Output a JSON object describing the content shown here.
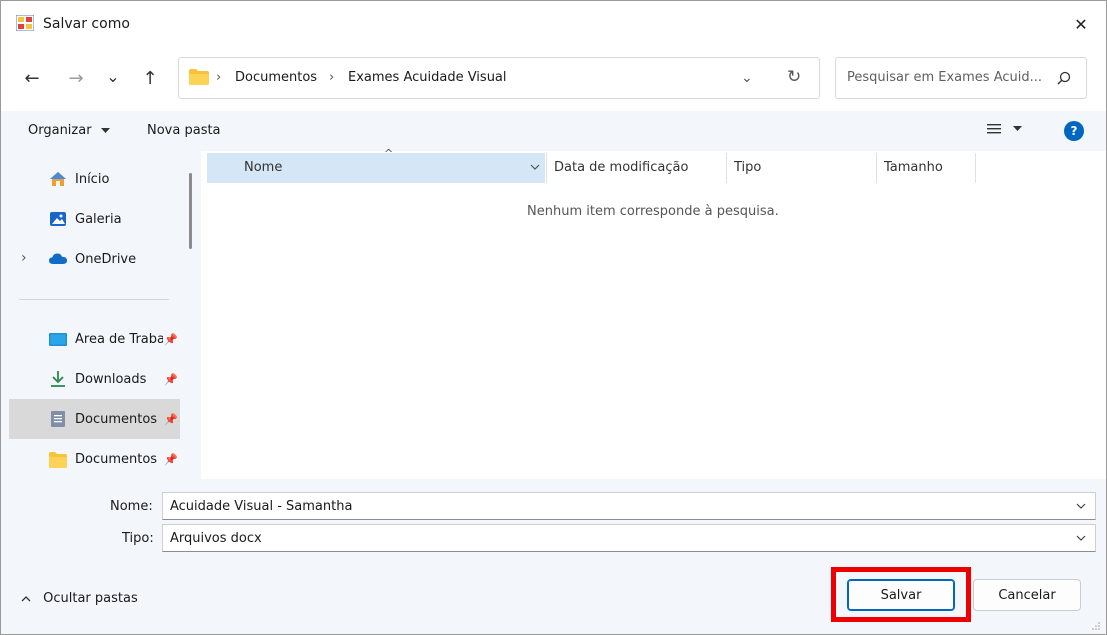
{
  "window": {
    "title": "Salvar como",
    "close_glyph": "✕"
  },
  "nav": {
    "back_glyph": "←",
    "forward_glyph": "→",
    "recent_glyph": "⌄",
    "up_glyph": "↑"
  },
  "address": {
    "separator": "›",
    "crumbs": [
      "Documentos",
      "Exames Acuidade Visual"
    ],
    "refresh_glyph": "↻"
  },
  "search": {
    "placeholder": "Pesquisar em Exames Acuid..."
  },
  "toolbar": {
    "organize_label": "Organizar",
    "new_folder_label": "Nova pasta",
    "help_glyph": "?"
  },
  "sidebar": {
    "items": [
      {
        "label": "Início",
        "icon": "home-icon"
      },
      {
        "label": "Galeria",
        "icon": "gallery-icon"
      },
      {
        "label": "OneDrive",
        "icon": "cloud-icon"
      },
      {
        "label": "Área de Trabalho",
        "icon": "desktop-icon",
        "pinned": true
      },
      {
        "label": "Downloads",
        "icon": "download-icon",
        "pinned": true
      },
      {
        "label": "Documentos",
        "icon": "document-icon",
        "pinned": true,
        "selected": true
      },
      {
        "label": "Documentos",
        "icon": "folder-icon",
        "pinned": true
      }
    ],
    "expand_glyph": "›",
    "pin_glyph": "📌"
  },
  "columns": {
    "headers": [
      "Nome",
      "Data de modificação",
      "Tipo",
      "Tamanho"
    ],
    "sort_glyph": "^"
  },
  "content": {
    "empty_message": "Nenhum item corresponde à pesquisa."
  },
  "form": {
    "name_label": "Nome:",
    "name_value": "Acuidade Visual - Samantha",
    "type_label": "Tipo:",
    "type_value": "Arquivos docx"
  },
  "footer": {
    "hide_folders_label": "Ocultar pastas",
    "save_label": "Salvar",
    "cancel_label": "Cancelar"
  },
  "colors": {
    "accent": "#0067c0",
    "folder": "#f8c33a",
    "highlight": "#ee0000",
    "selected_header": "#d5e6f7"
  }
}
